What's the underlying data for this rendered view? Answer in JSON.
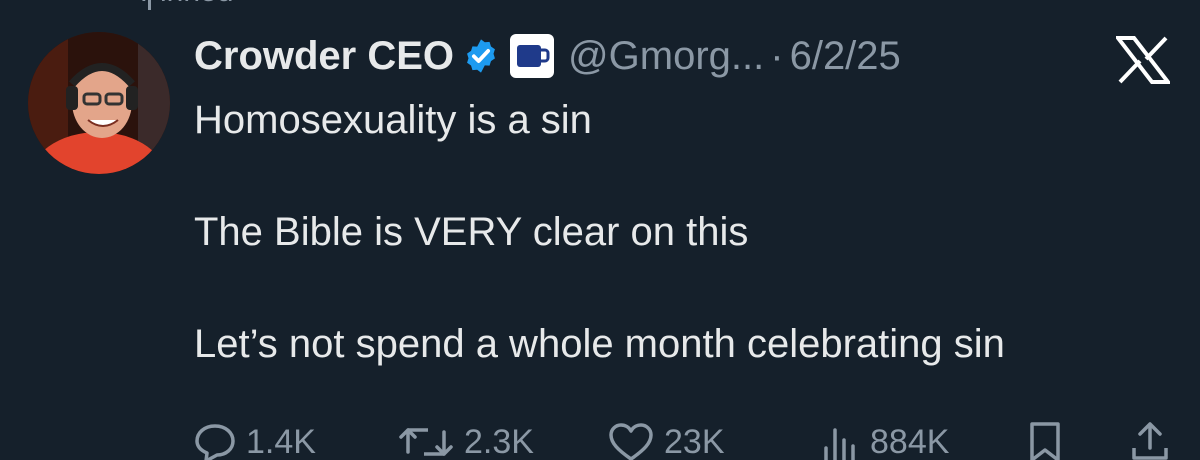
{
  "pinned_label": "Pinned",
  "tweet": {
    "display_name": "Crowder CEO",
    "affiliation_badge_text": "MUG CLUB",
    "handle": "@Gmorg...",
    "separator": "·",
    "date": "6/2/25",
    "lines": [
      "Homosexuality is a sin",
      "The Bible is VERY clear on this",
      "Let’s not spend a whole month celebrating sin"
    ]
  },
  "actions": {
    "replies": "1.4K",
    "reposts": "2.3K",
    "likes": "23K",
    "views": "884K"
  },
  "colors": {
    "background": "#15202b",
    "text": "#e7e9ea",
    "muted": "#8b98a5",
    "verified": "#1d9bf0",
    "mug_club": "#1f3a8a"
  },
  "icons": [
    "reply-icon",
    "repost-icon",
    "like-icon",
    "views-icon",
    "bookmark-icon",
    "share-icon",
    "x-logo-icon",
    "verified-badge-icon"
  ]
}
